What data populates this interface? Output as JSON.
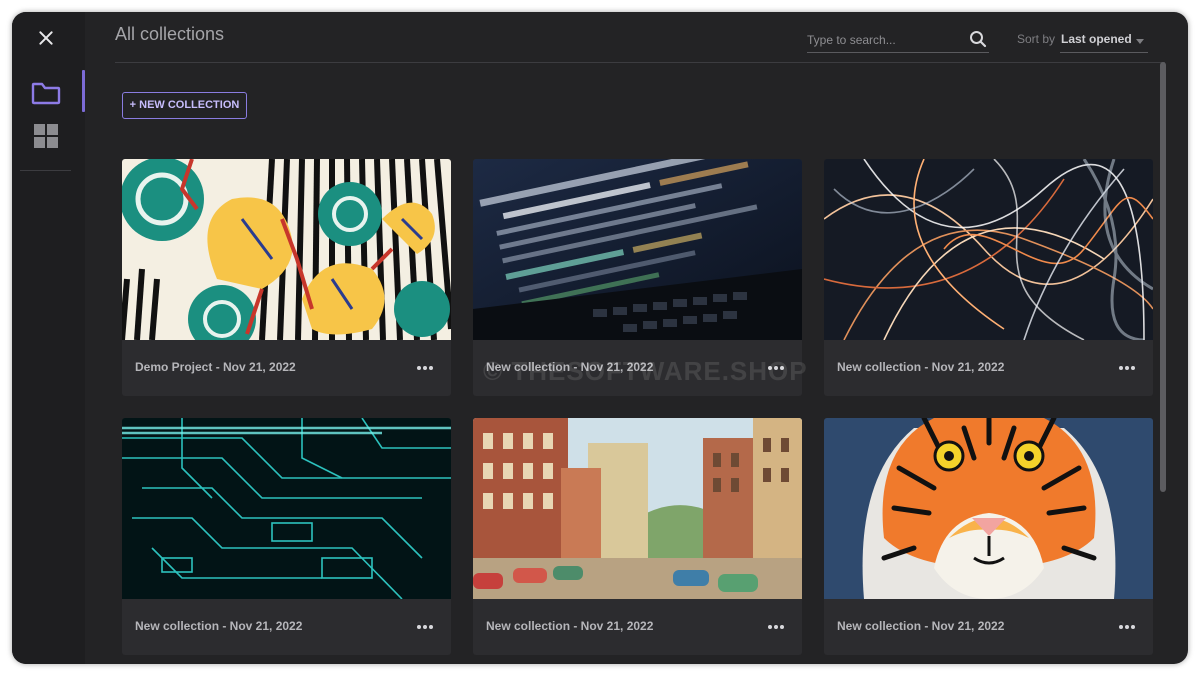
{
  "header": {
    "title": "All collections",
    "search_placeholder": "Type to search...",
    "sort_label": "Sort by",
    "sort_value": "Last opened"
  },
  "sidebar": {
    "close_icon": "close-icon",
    "items": [
      {
        "name": "collections",
        "icon": "folder-icon",
        "active": true
      },
      {
        "name": "apps",
        "icon": "grid-icon",
        "active": false
      }
    ]
  },
  "toolbar": {
    "new_collection_label": "+ NEW COLLECTION"
  },
  "collections": [
    {
      "title": "Demo Project - Nov 21, 2022",
      "thumbnail": "floral-pattern"
    },
    {
      "title": "New collection - Nov 21, 2022",
      "thumbnail": "code-laptop"
    },
    {
      "title": "New collection - Nov 21, 2022",
      "thumbnail": "light-trails"
    },
    {
      "title": "New collection - Nov 21, 2022",
      "thumbnail": "circuit-board"
    },
    {
      "title": "New collection - Nov 21, 2022",
      "thumbnail": "vintage-street"
    },
    {
      "title": "New collection - Nov 21, 2022",
      "thumbnail": "tiger-illustration"
    }
  ],
  "watermark": "© THESOFTWARE.SHOP",
  "colors": {
    "accent": "#7c6bd6",
    "background": "#232325",
    "card": "#2c2c2f"
  }
}
